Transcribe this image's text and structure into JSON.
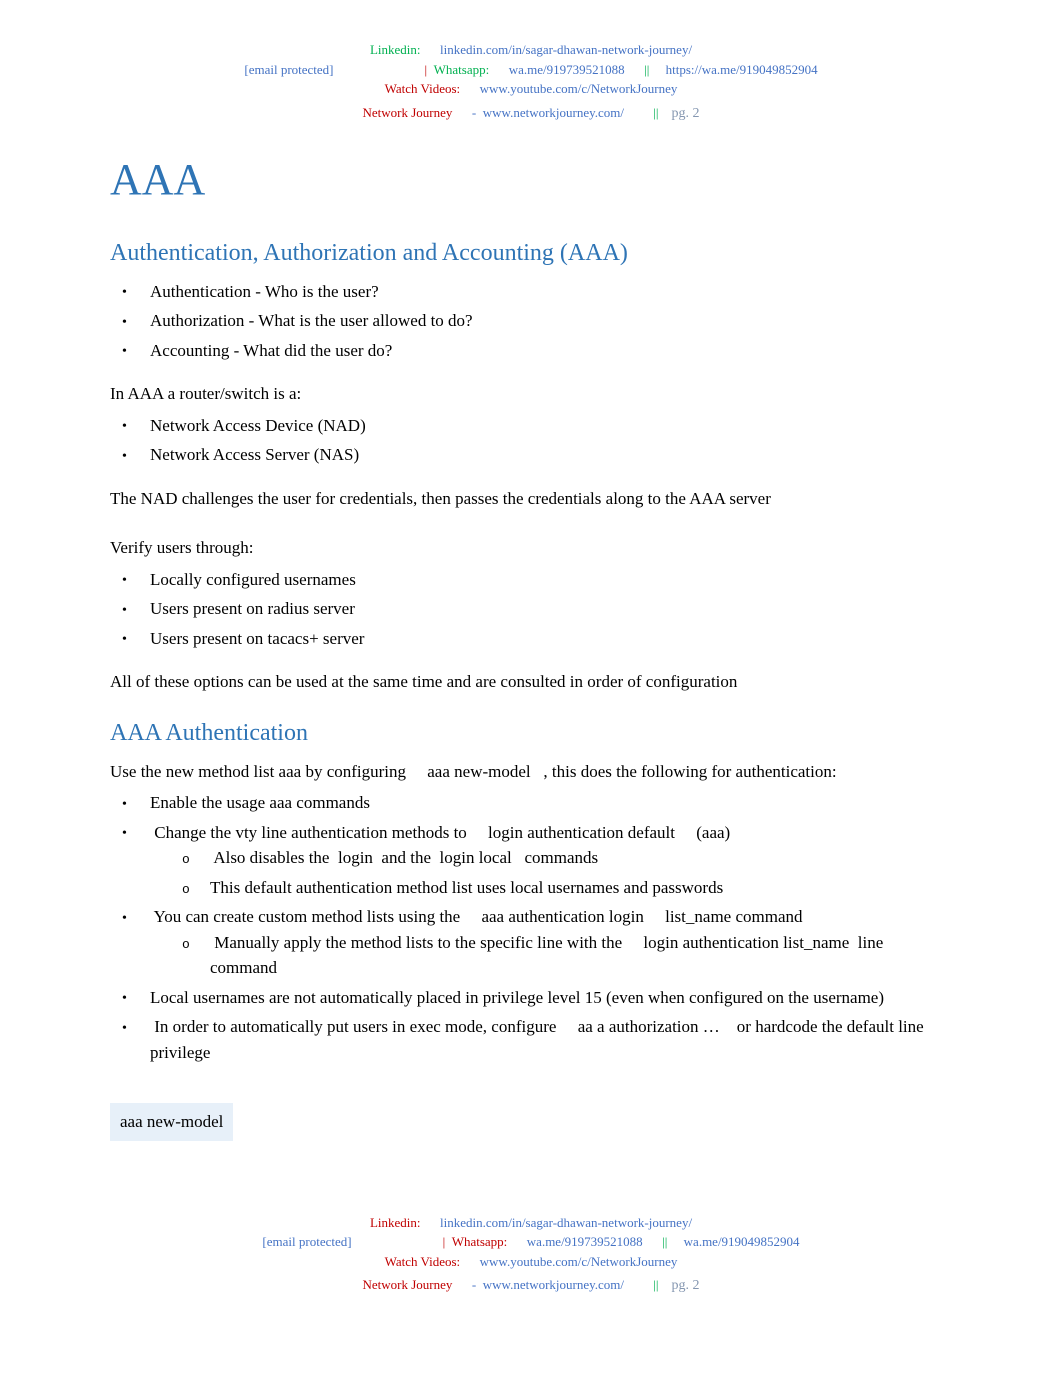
{
  "header": {
    "linkedin_label": "Linkedin:",
    "linkedin_url": "linkedin.com/in/sagar-dhawan-network-journey/",
    "email": "[email protected]",
    "whatsapp_label": "Whatsapp:",
    "whatsapp_url": "wa.me/919739521088",
    "whatsapp_alt": "https://wa.me/919049852904",
    "watch_label": "Watch Videos:",
    "youtube_url": "www.youtube.com/c/NetworkJourney",
    "brand": "Network Journey",
    "dash": "-",
    "site_url": "www.networkjourney.com/",
    "sep": "||",
    "sep_single": "|",
    "page_label": "pg. 2"
  },
  "title": "AAA",
  "section1": {
    "heading": "Authentication, Authorization and Accounting (AAA)",
    "bullets": [
      "Authentication - Who is the user?",
      "Authorization - What is the user allowed to do?",
      "Accounting - What did the user do?"
    ],
    "para1": "In AAA a router/switch is a:",
    "bullets2": [
      "Network Access Device (NAD)",
      "Network Access Server (NAS)"
    ],
    "para2": "The NAD challenges the user for credentials, then passes the credentials along to the AAA server",
    "para3": "Verify users through:",
    "bullets3": [
      "Locally configured usernames",
      "Users present on radius server",
      "Users present on tacacs+ server"
    ],
    "para4": "All of these options can be used at the same time and are consulted in order of configuration"
  },
  "section2": {
    "heading": "AAA Authentication",
    "para1_a": "Use the new method list aaa by configuring ",
    "cmd1": "aaa new-model",
    "para1_b": ", this does the following for authentication:",
    "b1": "Enable the usage aaa commands",
    "b2_a": "Change the vty line authentication methods to ",
    "b2_cmd": "login authentication default",
    "b2_b": " (aaa)",
    "b2_s1_a": "Also disables the ",
    "b2_s1_cmd1": "login",
    "b2_s1_b": " and the ",
    "b2_s1_cmd2": "login local",
    "b2_s1_c": " commands",
    "b2_s2": "This default authentication method list uses local usernames and passwords",
    "b3_a": "You can create custom method lists using the ",
    "b3_cmd": "aaa authentication login ",
    "b3_var": "list_name",
    "b3_b": " command",
    "b3_s1_a": "Manually apply the method lists to the specific line with the ",
    "b3_s1_cmd": "login authentication ",
    "b3_s1_var": "list_name",
    "b3_s1_b": " line command",
    "b4": "Local usernames are not automatically placed in privilege level 15 (even when configured on the username)",
    "b5_a": "In order to automatically put users in exec mode, configure ",
    "b5_cmd": "aa a authorization …",
    "b5_b": " or hardcode the default line privilege",
    "code": "aaa new-model"
  },
  "footer": {
    "whatsapp_alt": "wa.me/919049852904"
  }
}
